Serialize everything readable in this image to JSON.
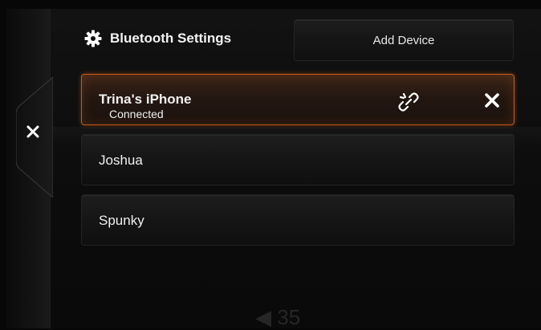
{
  "header": {
    "title": "Bluetooth Settings",
    "add_device_label": "Add Device"
  },
  "devices": [
    {
      "name": "Trina's iPhone",
      "status": "Connected",
      "active": true
    },
    {
      "name": "Joshua"
    },
    {
      "name": "Spunky"
    }
  ],
  "background": {
    "faded_value": "35"
  },
  "icons": {
    "settings": "gear-icon",
    "side_close": "close-icon",
    "disconnect": "broken-link-icon",
    "remove": "close-icon"
  },
  "colors": {
    "accent": "#c25a1c",
    "background": "#0c0c0c",
    "text": "#ffffff"
  }
}
